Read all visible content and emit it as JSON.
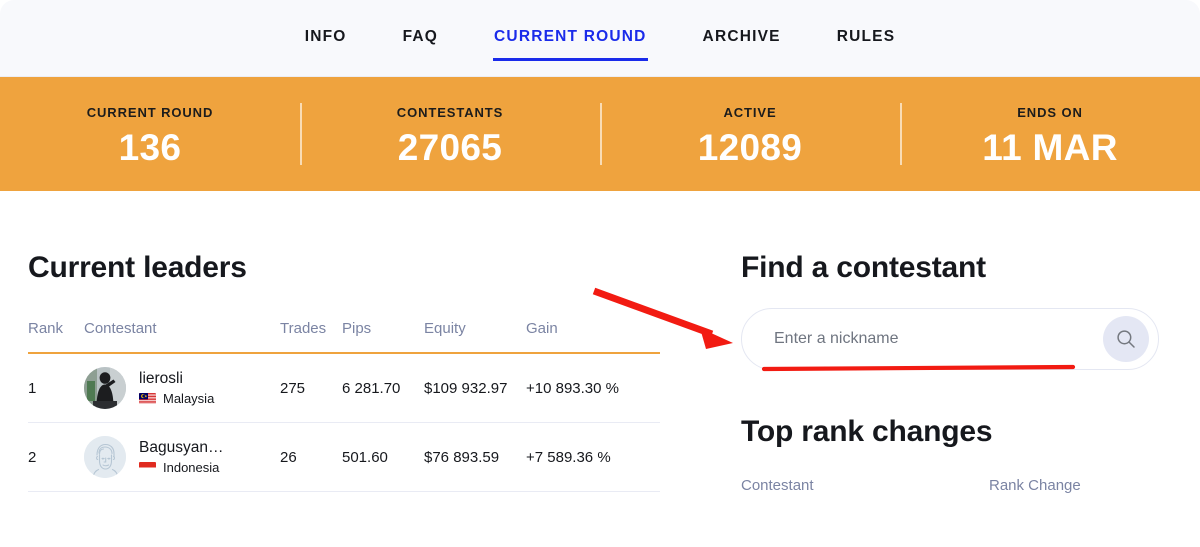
{
  "nav": {
    "items": [
      {
        "label": "INFO",
        "active": false
      },
      {
        "label": "FAQ",
        "active": false
      },
      {
        "label": "CURRENT ROUND",
        "active": true
      },
      {
        "label": "ARCHIVE",
        "active": false
      },
      {
        "label": "RULES",
        "active": false
      }
    ],
    "active_color": "#1a2bea"
  },
  "stats": {
    "background_color": "#efa33e",
    "items": [
      {
        "label": "CURRENT ROUND",
        "value": "136"
      },
      {
        "label": "CONTESTANTS",
        "value": "27065"
      },
      {
        "label": "ACTIVE",
        "value": "12089"
      },
      {
        "label": "ENDS ON",
        "value": "11 MAR"
      }
    ]
  },
  "leaders": {
    "title": "Current leaders",
    "accent_color": "#efa33e",
    "columns": [
      "Rank",
      "Contestant",
      "Trades",
      "Pips",
      "Equity",
      "Gain"
    ],
    "rows": [
      {
        "rank": "1",
        "name": "lierosli",
        "country": "Malaysia",
        "flag": "malaysia-flag-icon",
        "avatar": "photo-avatar",
        "trades": "275",
        "pips": "6 281.70",
        "equity": "$109 932.97",
        "gain": "+10 893.30 %"
      },
      {
        "rank": "2",
        "name": "Bagusyan…",
        "country": "Indonesia",
        "flag": "indonesia-flag-icon",
        "avatar": "placeholder-avatar",
        "trades": "26",
        "pips": "501.60",
        "equity": "$76 893.59",
        "gain": "+7 589.36 %"
      }
    ],
    "gain_color": "#24a148"
  },
  "find": {
    "title": "Find a contestant",
    "placeholder": "Enter a nickname",
    "value": "",
    "search_icon": "search-icon"
  },
  "rank_changes": {
    "title": "Top rank changes",
    "columns": [
      "Contestant",
      "Rank Change"
    ]
  },
  "annotations": {
    "arrow_color": "#f21b12",
    "underline_color": "#f21b12"
  }
}
